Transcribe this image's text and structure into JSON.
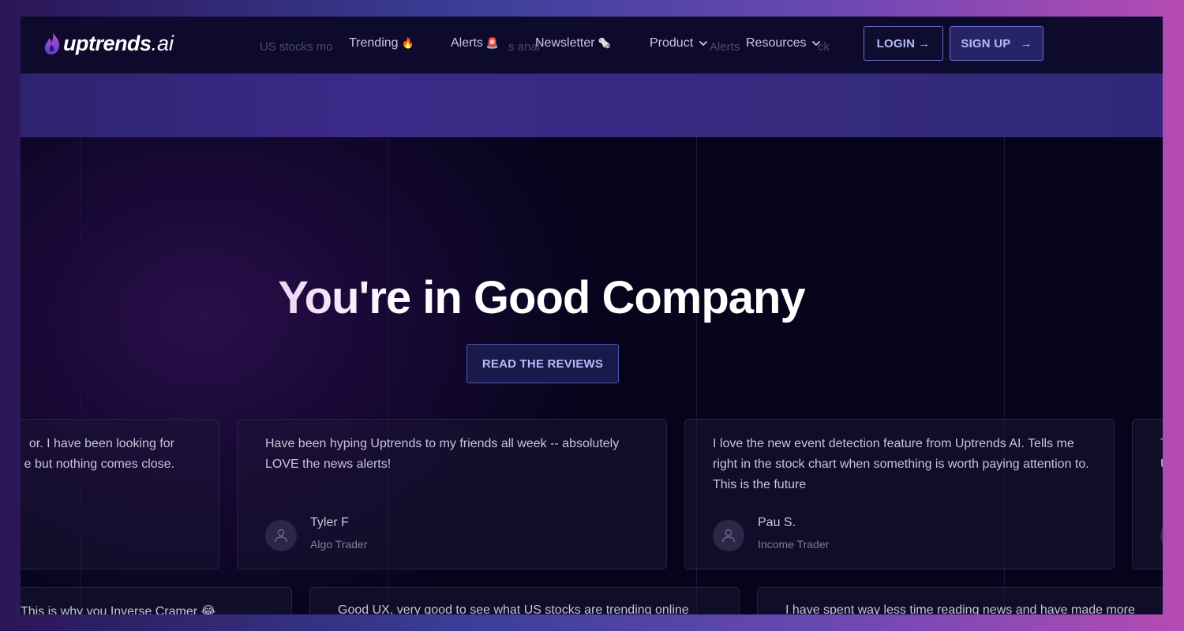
{
  "logo": {
    "main": "uptrends",
    "suffix": ".ai"
  },
  "ticker_ghost": [
    {
      "text": "US stocks mo",
      "key": "a"
    },
    {
      "text": "s anal",
      "key": "b"
    },
    {
      "text": "Alerts",
      "key": "c"
    },
    {
      "text": "ck",
      "key": "d"
    }
  ],
  "nav": {
    "items": [
      {
        "label": "Trending",
        "emoji": "🔥"
      },
      {
        "label": "Alerts",
        "emoji": "🚨"
      },
      {
        "label": "Newsletter",
        "emoji": "🗞️"
      },
      {
        "label": "Product"
      },
      {
        "label": "Resources"
      }
    ],
    "login": "LOGIN",
    "signup": "SIGN UP",
    "arrow": "→"
  },
  "hero": {
    "title": "You're in Good Company",
    "cta": "READ THE REVIEWS"
  },
  "reviews_row1": [
    {
      "line1": "or.  I have been looking for",
      "line2": "e but nothing comes close."
    },
    {
      "text": "Have been hyping Uptrends to my friends all week -- absolutely LOVE the news alerts!",
      "name": "Tyler F",
      "role": "Algo Trader"
    },
    {
      "text": "I love the new event detection feature from Uptrends AI. Tells me right in the stock chart when something is worth paying attention to. This is the future",
      "name": "Pau S.",
      "role": "Income Trader"
    },
    {
      "line1": "T",
      "line2": "U"
    }
  ],
  "reviews_row2": [
    {
      "text": "This is why you Inverse Cramer 😂"
    },
    {
      "text": "Good UX, very good to see what US stocks are trending online"
    },
    {
      "text": "I have spent way less time reading news and have made more"
    }
  ],
  "colors": {
    "accent": "#b5bcf6",
    "button_border": "#6770c7",
    "background": "#05041a",
    "banner": "#352a7e"
  }
}
